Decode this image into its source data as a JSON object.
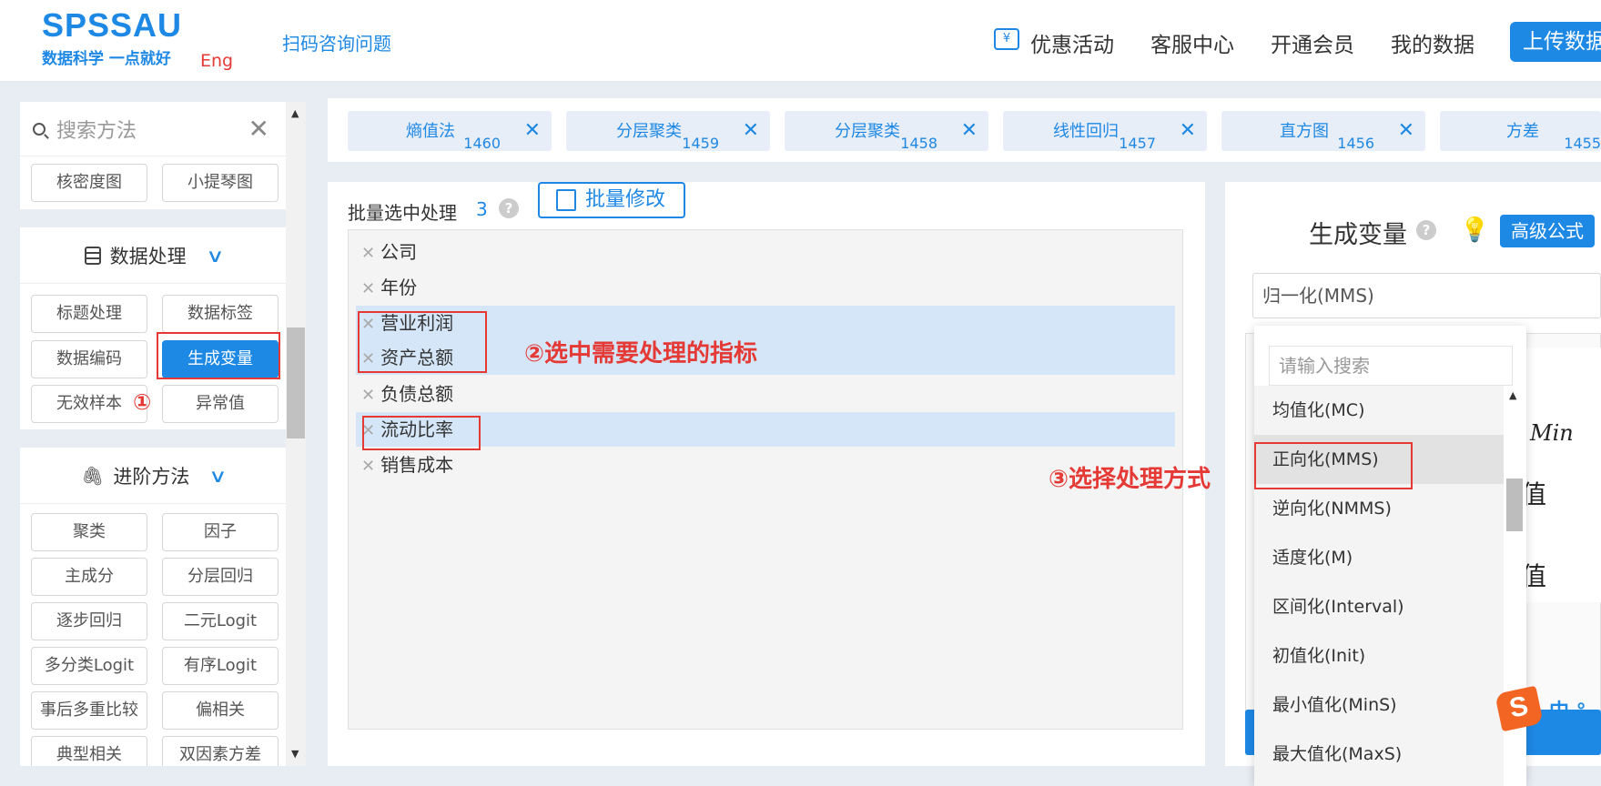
{
  "header": {
    "logo_main": "SPSSAU",
    "logo_sub": "数据科学 一点就好",
    "logo_eng": "Eng",
    "scan_link": "扫码咨询问题",
    "nav_items": [
      "优惠活动",
      "客服中心",
      "开通会员",
      "我的数据"
    ],
    "upload_label": "上传数据",
    "promo_icon_glyph": "¥"
  },
  "sidebar": {
    "search_placeholder": "搜索方法",
    "close_glyph": "✕",
    "top_buttons": [
      "核密度图",
      "小提琴图"
    ],
    "data_processing": {
      "title": "数据处理",
      "buttons": [
        "标题处理",
        "数据标签",
        "数据编码",
        "生成变量",
        "无效样本",
        "异常值"
      ],
      "active": "生成变量"
    },
    "advanced": {
      "title": "进阶方法",
      "buttons": [
        "聚类",
        "因子",
        "主成分",
        "分层回归",
        "逐步回归",
        "二元Logit",
        "多分类Logit",
        "有序Logit",
        "事后多重比较",
        "偏相关",
        "典型相关",
        "双因素方差"
      ]
    },
    "chevron_glyph": "∨",
    "clip_glyph": "🖇",
    "scroll_up_glyph": "▲",
    "scroll_down_glyph": "▼"
  },
  "tabs": [
    {
      "label": "熵值法",
      "num": "1460"
    },
    {
      "label": "分层聚类",
      "num": "1459"
    },
    {
      "label": "分层聚类",
      "num": "1458"
    },
    {
      "label": "线性回归",
      "num": "1457"
    },
    {
      "label": "直方图",
      "num": "1456"
    },
    {
      "label": "方差",
      "num": "1455"
    }
  ],
  "tab_close_glyph": "✕",
  "middle": {
    "batch_label": "批量选中处理",
    "batch_count": "3",
    "help_glyph": "?",
    "batch_edit_label": "批量修改",
    "variables": [
      "公司",
      "年份",
      "营业利润",
      "资产总额",
      "负债总额",
      "流动比率",
      "销售成本"
    ],
    "remove_glyph": "✕"
  },
  "annotations": {
    "step1": "①",
    "step2": "②选中需要处理的指标",
    "step3": "③选择处理方式"
  },
  "right": {
    "title": "生成变量",
    "advanced_formula_label": "高级公式",
    "bulb_glyph": "💡",
    "selected_method": "归一化(MMS)",
    "formula_lines": [
      "Min",
      "值",
      "值"
    ]
  },
  "dropdown": {
    "search_placeholder": "请输入搜索",
    "options": [
      "均值化(MC)",
      "正向化(MMS)",
      "逆向化(NMMS)",
      "适度化(M)",
      "区间化(Interval)",
      "初值化(Init)",
      "最小值化(MinS)",
      "最大值化(MaxS)"
    ],
    "hovered": "正向化(MMS)"
  },
  "ime": {
    "logo_glyph": "S",
    "text": "中 °,"
  }
}
